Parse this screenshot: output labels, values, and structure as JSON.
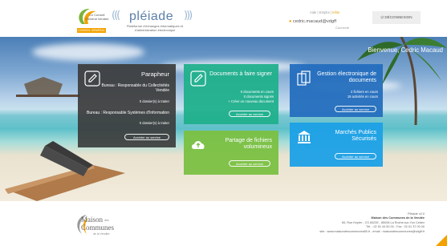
{
  "header": {
    "cg_logo": {
      "text": "Le Conseil Général Vendée",
      "tag": "CONSEIL GÉNÉRAL"
    },
    "pleiade": {
      "waves_left": "(((",
      "name": "pléiade",
      "waves_right": ")))",
      "tagline": "Plateforme d'échanges informatiques et d'administration électronique"
    },
    "user": {
      "links": [
        "Aide",
        "Emploi",
        "Infos"
      ],
      "links_sep": " | ",
      "name": "cedric.macaud@vdgff",
      "status": "Connecté"
    },
    "logout_label": "DÉCONNEXION"
  },
  "welcome": "Bienvenue, Cedric Macaud",
  "tiles": {
    "parapheur": {
      "title": "Parapheur",
      "bureau1": "Bureau : Responsable du Collectivités Vendée",
      "bureau1_count": "0 dossier(s) à traiter",
      "bureau2": "Bureau : Responsable Systèmes d'Information",
      "bureau2_count": "0 dossier(s) à traiter",
      "button": "Accéder au service"
    },
    "documents": {
      "title": "Documents à faire signer",
      "line1": "0 documents en cours",
      "line2": "0 documents signés",
      "line3": "+ Créer un nouveau document",
      "button": "Accéder au service"
    },
    "gestion": {
      "title": "Gestion électronique de documents",
      "line1": "2 fichiers en cours",
      "line2": "19 activités en cours",
      "button": "Accéder au service"
    },
    "partage": {
      "title": "Partage de fichiers volumineux",
      "button": "Accéder au service"
    },
    "marches": {
      "title": "Marchés Publics Sécurisés",
      "button": "Accéder au service"
    }
  },
  "footer": {
    "mdc": {
      "l1": "Maison",
      "l2": "des",
      "l3": "Communes",
      "l4": "de la Vendée"
    },
    "version": "Pléiade v2.0",
    "org": "Maison des Communes de la Vendée",
    "address": "65, Rue Kepler - CS 60239 - 85006 La Roche-sur-Yon Cedex",
    "phone": "Tél. : 02 51 44 50 00 - Fax : 02 51 37 00 00",
    "web": "site : www.maisondescommunes85.fr - email : maisondescommunes@vdgff.fr"
  },
  "colors": {
    "parapheur": "#3c3c3c",
    "documents": "#20b08c",
    "gestion": "#246ebe",
    "partage": "#7ac042",
    "marches": "#1ca0e6",
    "accent": "#f2a100"
  }
}
